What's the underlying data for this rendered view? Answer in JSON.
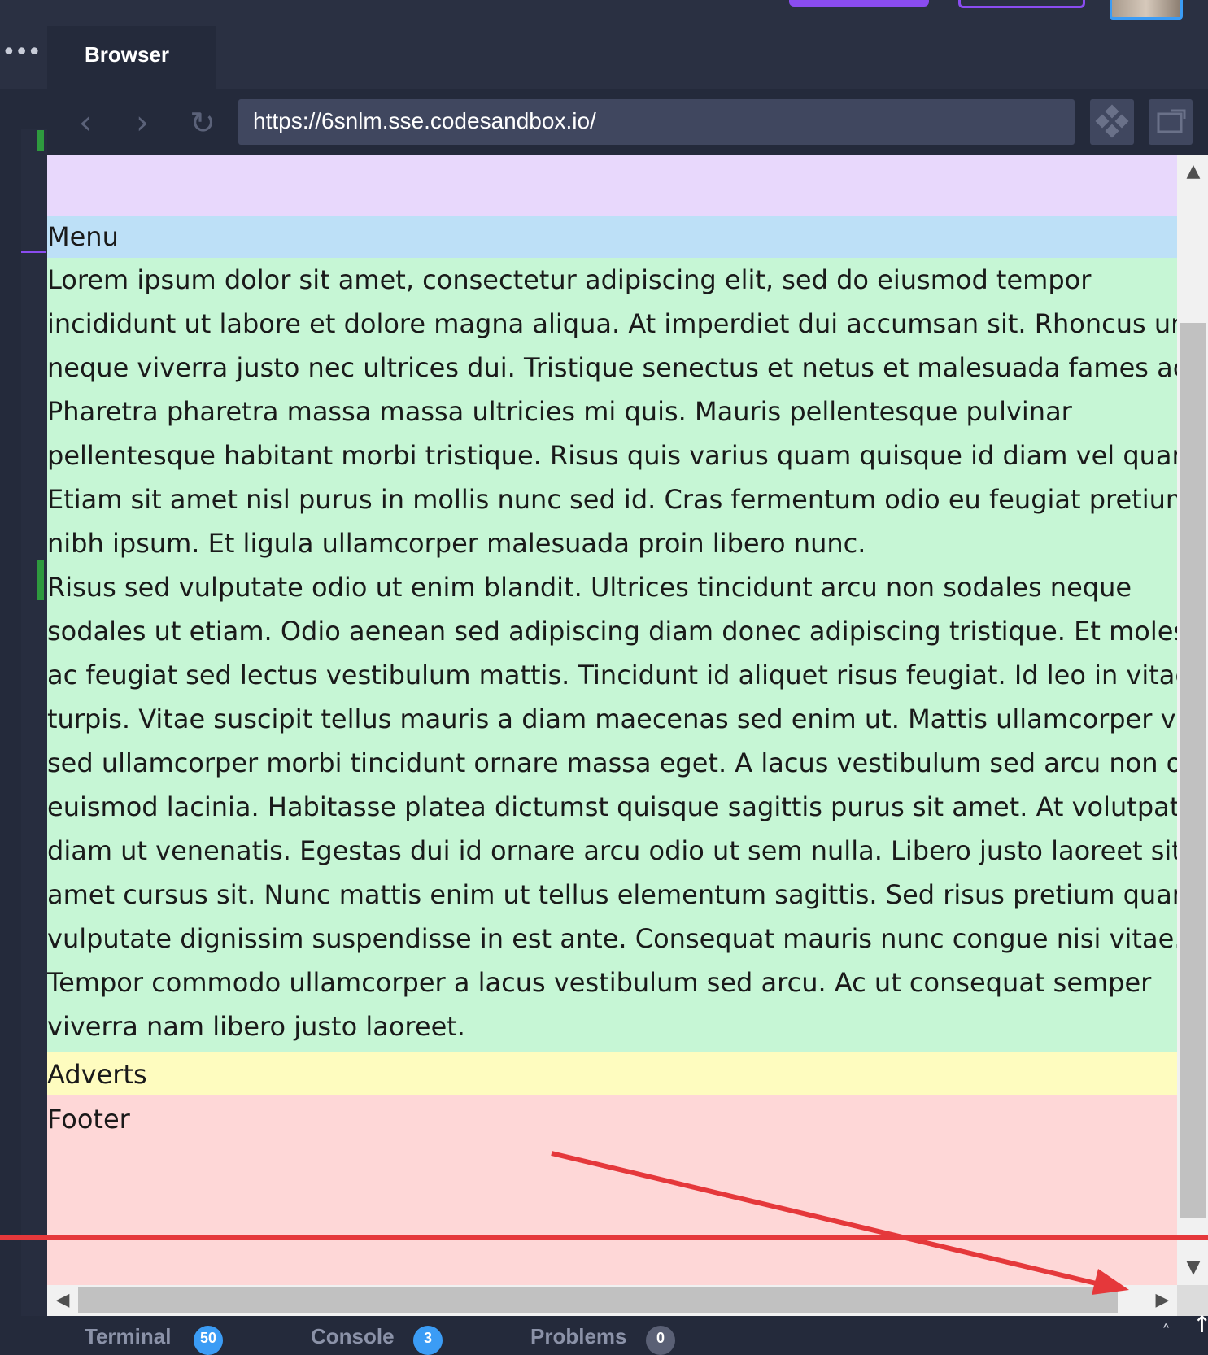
{
  "browser_tab": {
    "label": "Browser",
    "more_icon": "ellipsis-icon"
  },
  "nav": {
    "back_icon": "‹",
    "forward_icon": "›",
    "reload_icon": "↻",
    "url": "https://6snlm.sse.codesandbox.io/"
  },
  "page": {
    "menu": "Menu",
    "main_lines": [
      "Lorem ipsum dolor sit amet, consectetur adipiscing elit, sed do eiusmod tempor",
      "incididunt ut labore et dolore magna aliqua. At imperdiet dui accumsan sit. Rhoncus urn",
      "neque viverra justo nec ultrices dui. Tristique senectus et netus et malesuada fames ac.",
      "Pharetra pharetra massa massa ultricies mi quis. Mauris pellentesque pulvinar",
      "pellentesque habitant morbi tristique. Risus quis varius quam quisque id diam vel quam.",
      "Etiam sit amet nisl purus in mollis nunc sed id. Cras fermentum odio eu feugiat pretium",
      "nibh ipsum. Et ligula ullamcorper malesuada proin libero nunc.",
      "Risus sed vulputate odio ut enim blandit. Ultrices tincidunt arcu non sodales neque",
      "sodales ut etiam. Odio aenean sed adipiscing diam donec adipiscing tristique. Et molest",
      "ac feugiat sed lectus vestibulum mattis. Tincidunt id aliquet risus feugiat. Id leo in vitae",
      "turpis. Vitae suscipit tellus mauris a diam maecenas sed enim ut. Mattis ullamcorper veli",
      "sed ullamcorper morbi tincidunt ornare massa eget. A lacus vestibulum sed arcu non od",
      "euismod lacinia. Habitasse platea dictumst quisque sagittis purus sit amet. At volutpat",
      "diam ut venenatis. Egestas dui id ornare arcu odio ut sem nulla. Libero justo laoreet sit",
      "amet cursus sit. Nunc mattis enim ut tellus elementum sagittis. Sed risus pretium quam",
      "vulputate dignissim suspendisse in est ante. Consequat mauris nunc congue nisi vitae.",
      "Tempor commodo ullamcorper a lacus vestibulum sed arcu. Ac ut consequat semper",
      "viverra nam libero justo laoreet."
    ],
    "adverts": "Adverts",
    "footer": "Footer"
  },
  "bottom_tabs": [
    {
      "label": "Terminal",
      "badge": "50"
    },
    {
      "label": "Console",
      "badge": "3"
    },
    {
      "label": "Problems",
      "badge": "0"
    }
  ],
  "colors": {
    "header": "#e8d8fc",
    "menu": "#bde0f7",
    "main": "#c6f6d5",
    "adverts": "#fefcbf",
    "footer": "#fed7d7",
    "annotation": "#e5383b"
  }
}
